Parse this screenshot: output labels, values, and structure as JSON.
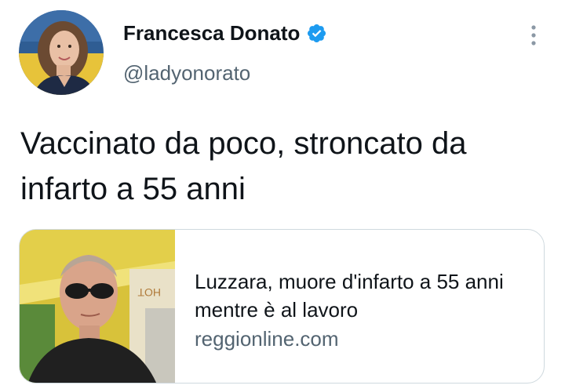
{
  "author": {
    "name": "Francesca Donato",
    "handle": "@ladyonorato",
    "verified": true
  },
  "tweet": {
    "text": "Vaccinato da poco, stroncato da infarto a 55 anni"
  },
  "link_card": {
    "title": "Luzzara, muore d'infarto a 55 anni mentre è al lavoro",
    "domain": "reggionline.com"
  },
  "icons": {
    "verified": "verified-badge-icon",
    "more": "more-options-icon"
  },
  "colors": {
    "verified_blue": "#1d9bf0",
    "secondary_text": "#536471",
    "card_border": "#cfd9de"
  }
}
